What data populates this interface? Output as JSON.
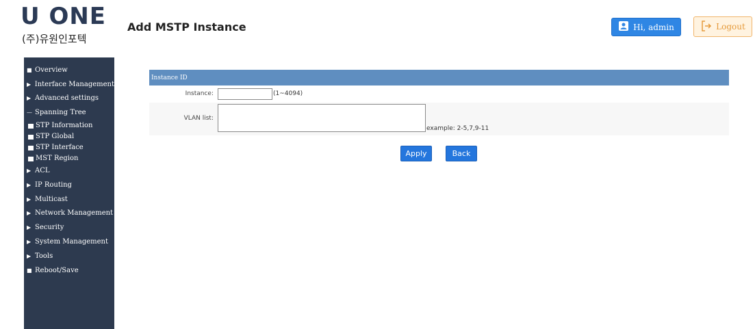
{
  "header": {
    "logo_text": "U ONE",
    "logo_subtext": "(주)유원인포텍",
    "page_title": "Add MSTP Instance",
    "user_label": "Hi, admin",
    "logout_label": "Logout",
    "user_icon": "user-card-icon",
    "logout_icon": "logout-icon"
  },
  "sidebar": {
    "items": [
      {
        "label": "Overview",
        "marker": "■"
      },
      {
        "label": "Interface Management",
        "marker": "▶"
      },
      {
        "label": "Advanced settings",
        "marker": "▶"
      },
      {
        "label": "Spanning Tree",
        "marker": "—"
      },
      {
        "label": "ACL",
        "marker": "▶"
      },
      {
        "label": "IP Routing",
        "marker": "▶"
      },
      {
        "label": "Multicast",
        "marker": "▶"
      },
      {
        "label": "Network Management",
        "marker": "▶"
      },
      {
        "label": "Security",
        "marker": "▶"
      },
      {
        "label": "System Management",
        "marker": "▶"
      },
      {
        "label": "Tools",
        "marker": "▶"
      },
      {
        "label": "Reboot/Save",
        "marker": "■"
      }
    ],
    "spanning_tree_sub": [
      {
        "label": "STP Information"
      },
      {
        "label": "STP Global"
      },
      {
        "label": "STP Interface"
      },
      {
        "label": "MST Region"
      }
    ]
  },
  "form": {
    "section_title": "Instance ID",
    "instance_label": "Instance:",
    "instance_value": "",
    "instance_hint": "(1~4094)",
    "vlan_label": "VLAN list:",
    "vlan_value": "",
    "vlan_hint": "example: 2-5,7,9-11",
    "apply_label": "Apply",
    "back_label": "Back"
  },
  "colors": {
    "sidebar_bg": "#2d3a4f",
    "panel_header": "#5f8ec0",
    "primary_button": "#2476dd",
    "user_button": "#2f86e4",
    "logout_border": "#f0b46a"
  }
}
